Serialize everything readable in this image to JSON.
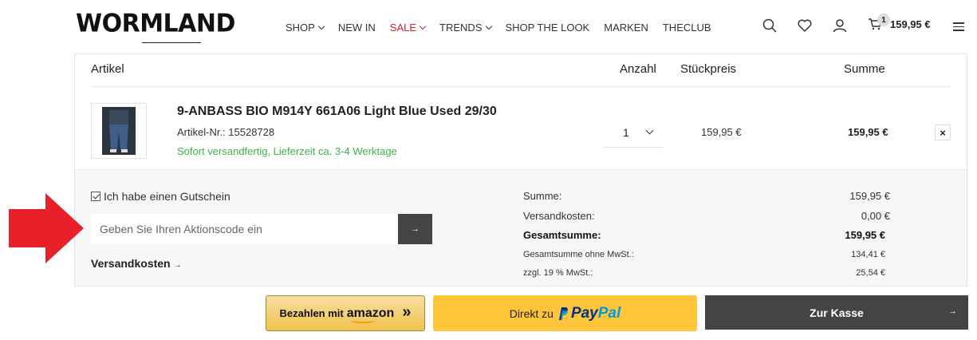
{
  "header": {
    "logo": "WORMLAND",
    "nav": [
      {
        "label": "SHOP",
        "dropdown": true,
        "sale": false
      },
      {
        "label": "NEW IN",
        "dropdown": false,
        "sale": false
      },
      {
        "label": "SALE",
        "dropdown": true,
        "sale": true
      },
      {
        "label": "TRENDS",
        "dropdown": true,
        "sale": false
      },
      {
        "label": "SHOP THE LOOK",
        "dropdown": false,
        "sale": false
      },
      {
        "label": "MARKEN",
        "dropdown": false,
        "sale": false
      },
      {
        "label": "THECLUB",
        "dropdown": false,
        "sale": false
      }
    ],
    "icons": [
      "search-icon",
      "heart-icon",
      "user-icon",
      "cart-icon",
      "menu-icon"
    ],
    "cart_count": "1",
    "cart_total": "159,95 €"
  },
  "table": {
    "col_article": "Artikel",
    "col_qty": "Anzahl",
    "col_unit": "Stückpreis",
    "col_sum": "Summe"
  },
  "item": {
    "name": "9-ANBASS BIO M914Y 661A06 Light Blue Used 29/30",
    "article_no": "Artikel-Nr.: 15528728",
    "shipping": "Sofort versandfertig, Lieferzeit ca. 3-4 Werktage",
    "qty": "1",
    "unit_price": "159,95 €",
    "line_sum": "159,95 €",
    "remove": "×"
  },
  "voucher": {
    "checkbox_label": "Ich habe einen Gutschein",
    "checked": true,
    "placeholder": "Geben Sie Ihren Aktionscode ein",
    "submit": "→"
  },
  "shipping_link": "Versandkosten",
  "summary": {
    "sum_label": "Summe:",
    "sum_value": "159,95 €",
    "ship_label": "Versandkosten:",
    "ship_value": "0,00 €",
    "total_label": "Gesamtsumme:",
    "total_value": "159,95 €",
    "net_label": "Gesamtsumme ohne MwSt.:",
    "net_value": "134,41 €",
    "vat_label": "zzgl. 19 % MwSt.:",
    "vat_value": "25,54 €"
  },
  "buttons": {
    "amazon_prefix": "Bezahlen mit",
    "amazon_word": "amazon",
    "amazon_chevrons": "»",
    "paypal_prefix": "Direkt zu",
    "paypal_p1": "Pay",
    "paypal_p2": "Pal",
    "checkout": "Zur Kasse",
    "checkout_arrow": "→"
  },
  "colors": {
    "sale": "#d0202f",
    "in_stock": "#3bb34a",
    "annotation_arrow": "#e8202a",
    "paypal_yellow": "#ffc439",
    "checkout_dark": "#444444"
  }
}
